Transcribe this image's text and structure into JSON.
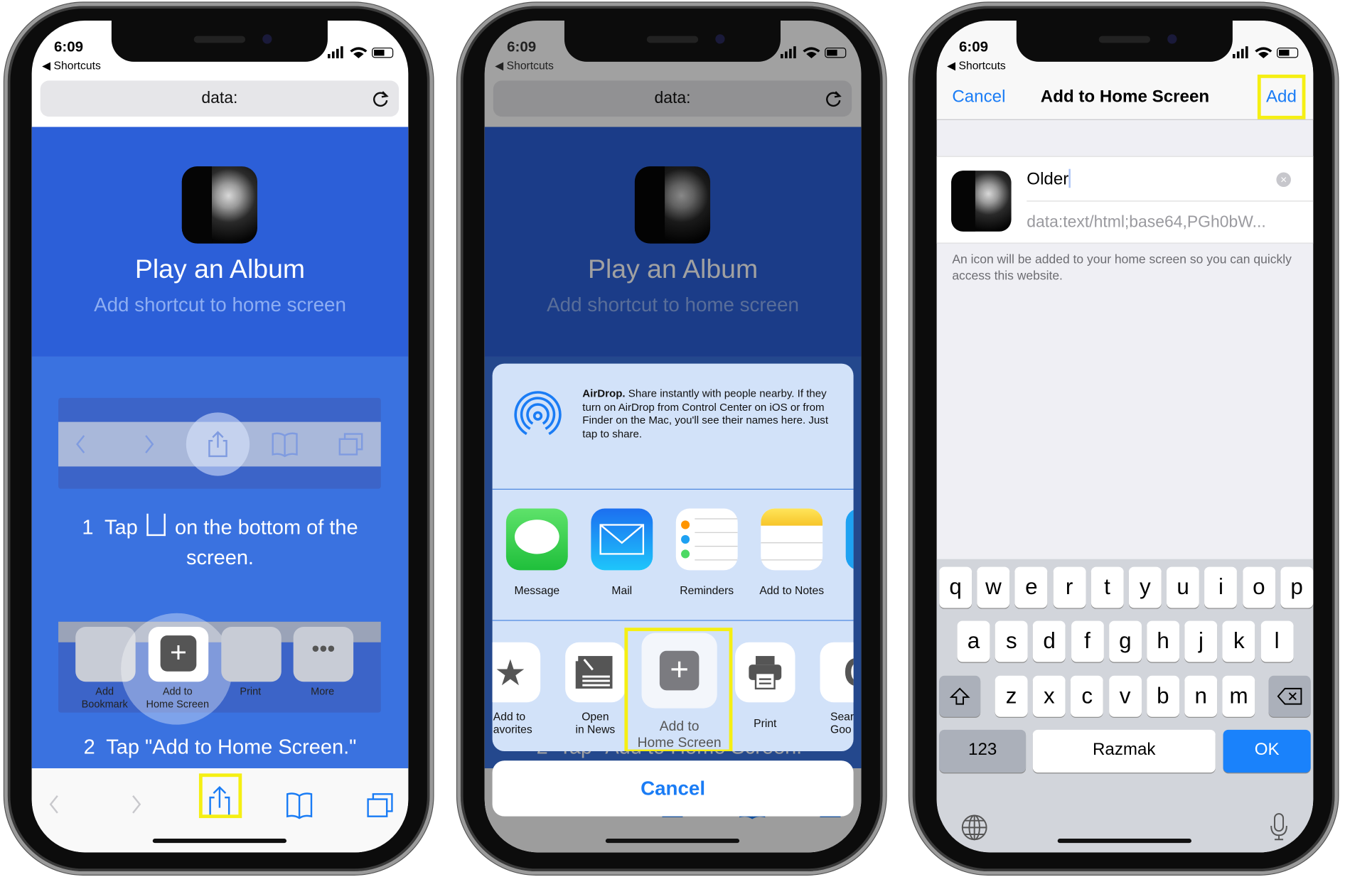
{
  "status": {
    "time": "6:09",
    "back": "Shortcuts"
  },
  "browser": {
    "url": "data:"
  },
  "page": {
    "title": "Play an Album",
    "subtitle": "Add shortcut to home screen",
    "step1_num": "1",
    "step1_pre": "Tap",
    "step1_post": "on the bottom of the",
    "step1_line2": "screen.",
    "step2_num": "2",
    "step2_text": "Tap \"Add to Home Screen.\"",
    "mini_actions": [
      {
        "line1": "Add",
        "line2": "Bookmark"
      },
      {
        "line1": "Add to",
        "line2": "Home Screen"
      },
      {
        "line1": "Print",
        "line2": ""
      },
      {
        "line1": "More",
        "line2": ""
      }
    ]
  },
  "share_sheet": {
    "airdrop_title": "AirDrop.",
    "airdrop_text": " Share instantly with people nearby. If they turn on AirDrop from Control Center on iOS or from Finder on the Mac, you'll see their names here. Just tap to share.",
    "apps": [
      "Message",
      "Mail",
      "Reminders",
      "Add to Notes"
    ],
    "actions": [
      {
        "line1": "Add to",
        "line2": "avorites"
      },
      {
        "line1": "Open",
        "line2": "in News"
      },
      {
        "line1": "Add to",
        "line2": "Home Screen"
      },
      {
        "line1": "Print",
        "line2": ""
      },
      {
        "line1": "Sear",
        "line2": "Goo"
      }
    ],
    "cancel": "Cancel"
  },
  "add_screen": {
    "cancel": "Cancel",
    "title": "Add to Home Screen",
    "add": "Add",
    "name_value": "Older",
    "url_value": "data:text/html;base64,PGh0bW...",
    "footnote": "An icon will be added to your home screen so you can quickly access this website."
  },
  "keyboard": {
    "rows": [
      [
        "q",
        "w",
        "e",
        "r",
        "t",
        "y",
        "u",
        "i",
        "o",
        "p"
      ],
      [
        "a",
        "s",
        "d",
        "f",
        "g",
        "h",
        "j",
        "k",
        "l"
      ],
      [
        "z",
        "x",
        "c",
        "v",
        "b",
        "n",
        "m"
      ]
    ],
    "numbers": "123",
    "space": "Razmak",
    "ok": "OK"
  },
  "colors": {
    "accent": "#1a7cf5",
    "highlight": "#f5ef13",
    "hero": "#2c5fd8",
    "page": "#3a72e0",
    "ok_key": "#1a82fb"
  }
}
